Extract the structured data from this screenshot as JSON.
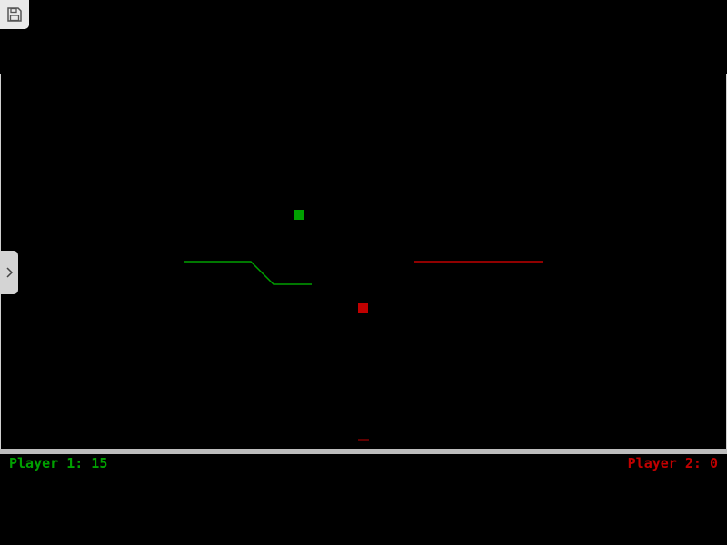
{
  "toolbar": {
    "save_icon": "floppy-disk-icon"
  },
  "sidebar": {
    "toggle_icon": "chevron-right-icon"
  },
  "colors": {
    "player1": "#00a000",
    "player2": "#c00000",
    "background": "#000000",
    "border": "#cfcfcf",
    "divider": "#bdbdbd"
  },
  "scoreboard": {
    "player1": "Player 1: 15",
    "player2": "Player 2: 0"
  }
}
